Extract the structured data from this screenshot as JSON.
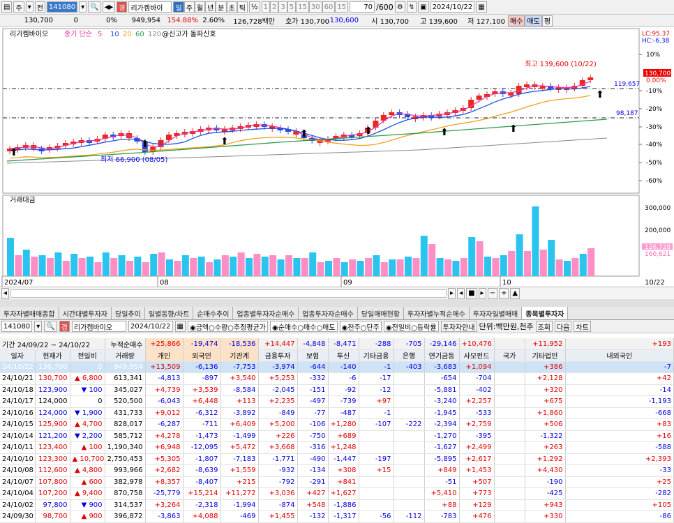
{
  "toolbar1": {
    "mode": "주",
    "prev": "전",
    "code": "141080",
    "name": "리가켐바이",
    "periods": [
      "일",
      "주",
      "월",
      "년",
      "분",
      "초",
      "틱"
    ],
    "nums": [
      "1",
      "2",
      "3",
      "5",
      "15",
      "30",
      "60",
      "15"
    ],
    "count": "70",
    "countMax": "/600",
    "date": "2024/10/22"
  },
  "toolbar2": {
    "price": "130,700",
    "change": "0",
    "pct": "0%",
    "volume": "949,954",
    "ratio1": "154.88%",
    "ratio2": "2.60%",
    "amount": "126,728백만",
    "quote": "호가 130,700",
    "quote2": "130,600",
    "open": "시 130,700",
    "high": "고 139,600",
    "low": "저 127,100",
    "buy": "매수",
    "sell": "매도",
    "eval": "평"
  },
  "chart": {
    "legend_name": "리가켐바이오",
    "legend_ma": "종가 단순",
    "ma": [
      "5",
      "10",
      "20",
      "60",
      "120"
    ],
    "signal": "@신고가 돌파신호",
    "lc": "LC:95.37",
    "hc": "HC:-6.38",
    "high_label": "최고 139,600 (10/22)",
    "low_label": "최저 66,900 (08/05)",
    "price_tag": "130,700",
    "pct_tag": "0.00%",
    "line1": "119,657",
    "line2": "98,187",
    "pct_axis": [
      "10%",
      "-10%",
      "-20%",
      "-30%",
      "-40%",
      "-50%",
      "-60%"
    ],
    "vol_title": "거래대금",
    "vol_axis": [
      "300,000",
      "200,000"
    ],
    "vol_tag1": "126,728",
    "vol_tag2": "160,621",
    "dates": [
      "2024/07",
      "08",
      "09",
      "10"
    ],
    "end_date": "10/22",
    "colors": {
      "up": "#e8271f",
      "down": "#1f4fe0",
      "ma5": "#e83aa8",
      "ma20": "#f0a020",
      "ma60": "#2a9a4a",
      "ma120": "#888888",
      "vol_up": "#ff8ec6",
      "vol_dn": "#2ac4ee"
    }
  },
  "tabs": [
    "투자자별매매종합",
    "시간대별투자자",
    "당일추이",
    "일별동향/차트",
    "순매수추이",
    "업종별투자자순매수",
    "업종투자자순매수",
    "당일매매현황",
    "투자자별누적순매수",
    "투자자일별매매",
    "종목별투자자"
  ],
  "ctrl": {
    "code": "141080",
    "name": "리가켐바이오",
    "date": "2024/10/22",
    "opts1": [
      "금액",
      "수량",
      "추정평균가"
    ],
    "opts2": [
      "순매수",
      "매수",
      "매도"
    ],
    "opts3": [
      "천주",
      "단주"
    ],
    "opts4": [
      "전일비",
      "등락률"
    ],
    "info": "투자자안내",
    "unit": "단위:백만원,천주",
    "query": "조회",
    "next": "다음",
    "chart": "차트"
  },
  "period": {
    "label": "기간",
    "from": "24/09/22",
    "to": "24/10/22",
    "sumlabel": "누적순매수",
    "sums": [
      "+25,866",
      "-19,474",
      "-18,536",
      "+14,447",
      "-4,848",
      "-8,471",
      "-288",
      "-705",
      "-29,146",
      "+10,476",
      "",
      "+11,952",
      "+193"
    ]
  },
  "headers": [
    "일자",
    "현재가",
    "전일비",
    "거래량",
    "개인",
    "외국인",
    "기관계",
    "금융투자",
    "보험",
    "투신",
    "기타금융",
    "은행",
    "연기금등",
    "사모펀드",
    "국가",
    "기타법인",
    "내외국인"
  ],
  "rows": [
    [
      "24/10/22",
      "130,700",
      "",
      "0",
      "949,954",
      "+13,509",
      "-6,136",
      "-7,753",
      "-3,974",
      "-644",
      "-140",
      "-1",
      "-403",
      "-3,683",
      "+1,094",
      "",
      "+386",
      "-7"
    ],
    [
      "24/10/21",
      "130,700",
      "up",
      "6,800",
      "613,341",
      "-4,813",
      "-897",
      "+3,540",
      "+5,253",
      "-332",
      "-6",
      "-17",
      "",
      "-654",
      "-704",
      "",
      "+2,128",
      "+42"
    ],
    [
      "24/10/18",
      "123,900",
      "dn",
      "100",
      "345,027",
      "+4,739",
      "+3,539",
      "-8,584",
      "-2,045",
      "-151",
      "-92",
      "-12",
      "",
      "-5,881",
      "-402",
      "",
      "+320",
      "-14"
    ],
    [
      "24/10/17",
      "124,000",
      "",
      "0",
      "520,500",
      "-6,043",
      "+6,448",
      "+113",
      "+2,235",
      "-497",
      "-739",
      "+97",
      "",
      "-3,240",
      "+2,257",
      "",
      "+675",
      "-1,193"
    ],
    [
      "24/10/16",
      "124,000",
      "dn",
      "1,900",
      "431,733",
      "+9,012",
      "-6,312",
      "-3,892",
      "-849",
      "-77",
      "-487",
      "-1",
      "",
      "-1,945",
      "-533",
      "",
      "+1,860",
      "-668"
    ],
    [
      "24/10/15",
      "125,900",
      "up",
      "4,700",
      "828,017",
      "-6,287",
      "-711",
      "+6,409",
      "+5,200",
      "-106",
      "+1,280",
      "-107",
      "-222",
      "-2,394",
      "+2,759",
      "",
      "+506",
      "+83"
    ],
    [
      "24/10/14",
      "121,200",
      "dn",
      "2,200",
      "585,712",
      "+4,278",
      "-1,473",
      "-1,499",
      "+226",
      "-750",
      "+689",
      "",
      "",
      "-1,270",
      "-395",
      "",
      "-1,322",
      "+16"
    ],
    [
      "24/10/11",
      "123,400",
      "up",
      "100",
      "1,190,340",
      "+6,948",
      "-12,095",
      "+5,472",
      "+3,668",
      "-316",
      "+1,248",
      "",
      "",
      "-1,627",
      "+2,499",
      "",
      "+263",
      "-588"
    ],
    [
      "24/10/10",
      "123,300",
      "up",
      "10,700",
      "2,750,453",
      "+5,305",
      "-1,807",
      "-7,183",
      "-1,771",
      "-490",
      "-1,447",
      "-197",
      "",
      "-5,895",
      "+2,617",
      "",
      "+1,292",
      "+2,393"
    ],
    [
      "24/10/08",
      "112,600",
      "up",
      "4,800",
      "993,966",
      "+2,682",
      "-8,639",
      "+1,559",
      "-932",
      "-134",
      "+308",
      "+15",
      "",
      "+849",
      "+1,453",
      "",
      "+4,430",
      "-33"
    ],
    [
      "24/10/07",
      "107,800",
      "up",
      "600",
      "382,978",
      "+8,357",
      "-8,407",
      "+215",
      "-792",
      "-291",
      "+841",
      "",
      "",
      "-51",
      "+507",
      "",
      "-190",
      "+25"
    ],
    [
      "24/10/04",
      "107,200",
      "up",
      "9,400",
      "870,758",
      "-25,779",
      "+15,214",
      "+11,272",
      "+3,036",
      "+427",
      "+1,627",
      "",
      "",
      "+5,410",
      "+773",
      "",
      "-425",
      "-282"
    ],
    [
      "24/10/02",
      "97,800",
      "dn",
      "900",
      "314,537",
      "+3,264",
      "-2,318",
      "-1,994",
      "-874",
      "+548",
      "-1,886",
      "",
      "",
      "+88",
      "+129",
      "",
      "+943",
      "+105"
    ],
    [
      "24/09/30",
      "98,700",
      "up",
      "900",
      "396,872",
      "-3,863",
      "+4,088",
      "-469",
      "+1,455",
      "-132",
      "-1,317",
      "-56",
      "-112",
      "-783",
      "+476",
      "",
      "+330",
      "-86"
    ]
  ]
}
